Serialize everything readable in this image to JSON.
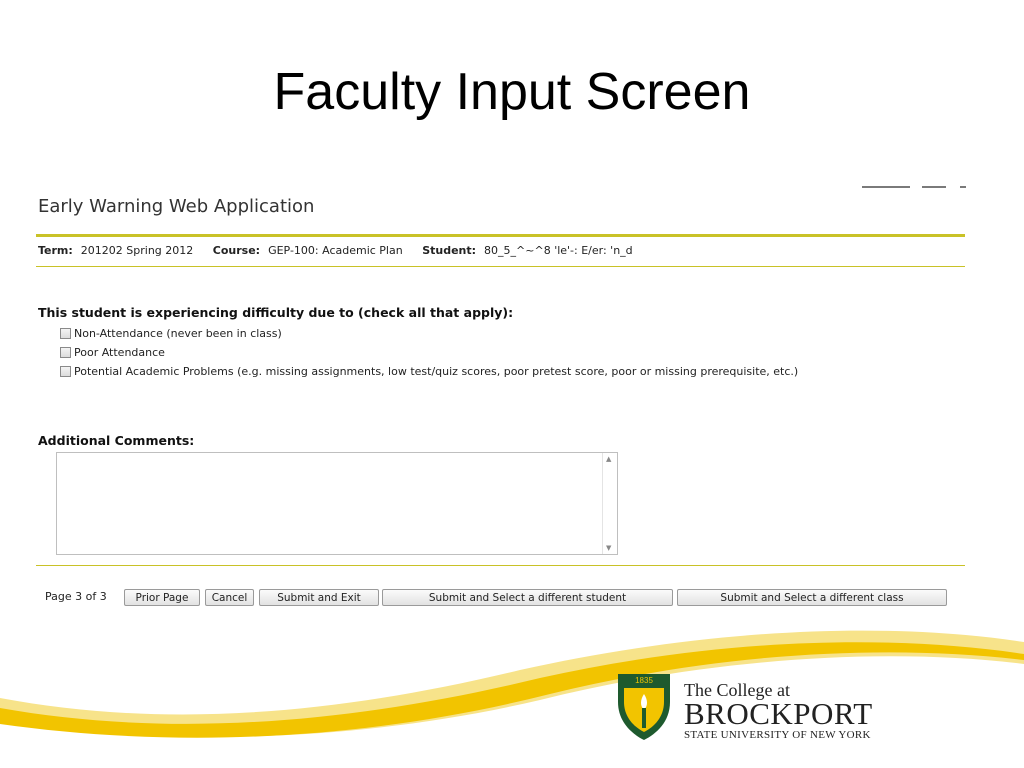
{
  "slide": {
    "title": "Faculty Input Screen"
  },
  "app": {
    "title": "Early Warning Web Application"
  },
  "info": {
    "term_label": "Term:",
    "term_value": "201202 Spring 2012",
    "course_label": "Course:",
    "course_value": "GEP-100: Academic Plan",
    "student_label": "Student:",
    "student_value": "80_5_^~^8 'le'-: E/er: 'n_d"
  },
  "form": {
    "question": "This student is experiencing difficulty due to (check all that apply):",
    "options": [
      {
        "label": "Non-Attendance (never been in class)",
        "checked": false
      },
      {
        "label": "Poor Attendance",
        "checked": false
      },
      {
        "label": "Potential Academic Problems (e.g. missing assignments, low test/quiz scores, poor pretest score, poor or missing prerequisite, etc.)",
        "checked": false
      }
    ],
    "comments_label": "Additional Comments:",
    "comments_value": ""
  },
  "footer": {
    "page_indicator": "Page 3 of 3",
    "buttons": {
      "prior": "Prior Page",
      "cancel": "Cancel",
      "submit_exit": "Submit and Exit",
      "submit_student": "Submit and Select a different student",
      "submit_class": "Submit and Select a different class"
    }
  },
  "logo": {
    "line1": "The College at",
    "line2": "BROCKPORT",
    "line3": "STATE UNIVERSITY OF NEW YORK",
    "seal_text": "1835"
  },
  "colors": {
    "accent_rule": "#c9c227",
    "swoosh_yellow": "#f2c400",
    "swoosh_light": "#f7e38a",
    "brand_green": "#1e5a2e"
  }
}
